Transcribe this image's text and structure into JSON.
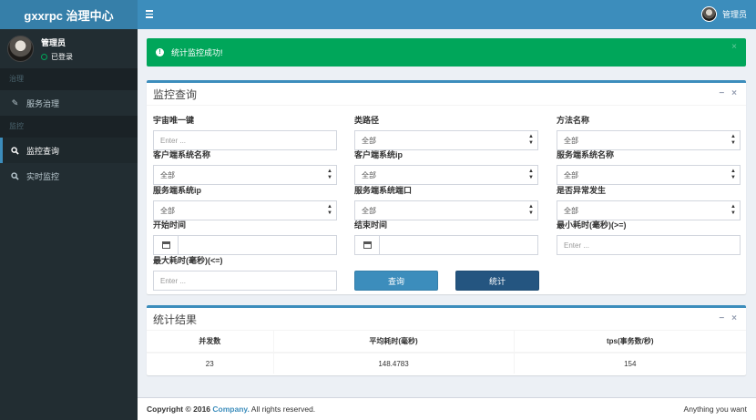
{
  "app": {
    "logo": "gxxrpc 治理中心"
  },
  "header": {
    "user_name": "管理员"
  },
  "sidebar": {
    "user": {
      "name": "管理员",
      "status": "已登录"
    },
    "sections": [
      {
        "header": "治理",
        "items": [
          {
            "label": "服务治理",
            "icon": "pencil-icon"
          }
        ]
      },
      {
        "header": "监控",
        "items": [
          {
            "label": "监控查询",
            "icon": "search-icon",
            "active": true
          },
          {
            "label": "实时监控",
            "icon": "search-icon"
          }
        ]
      }
    ]
  },
  "alert": {
    "message": "统计监控成功!",
    "close": "×",
    "color": "#00a65a"
  },
  "search": {
    "title": "监控查询",
    "fields": {
      "universe_key": {
        "label": "宇宙唯一键",
        "placeholder": "Enter ..."
      },
      "class_path": {
        "label": "类路径",
        "value": "全部"
      },
      "method_name": {
        "label": "方法名称",
        "value": "全部"
      },
      "client_system": {
        "label": "客户端系统名称",
        "value": "全部"
      },
      "client_ip": {
        "label": "客户端系统ip",
        "value": "全部"
      },
      "server_system": {
        "label": "服务端系统名称",
        "value": "全部"
      },
      "server_ip": {
        "label": "服务端系统ip",
        "value": "全部"
      },
      "server_port": {
        "label": "服务端系统端口",
        "value": "全部"
      },
      "exception": {
        "label": "是否异常发生",
        "value": "全部"
      },
      "start_time": {
        "label": "开始时间",
        "value": ""
      },
      "end_time": {
        "label": "结束时间",
        "value": ""
      },
      "min_cost": {
        "label": "最小耗时(毫秒)(>=)",
        "placeholder": "Enter ..."
      },
      "max_cost": {
        "label": "最大耗时(毫秒)(<=)",
        "placeholder": "Enter ..."
      }
    },
    "buttons": {
      "query": "查询",
      "stats": "统计"
    }
  },
  "results": {
    "title": "统计结果",
    "columns": [
      "并发数",
      "平均耗时(毫秒)",
      "tps(事务数/秒)"
    ],
    "rows": [
      [
        "23",
        "148.4783",
        "154"
      ]
    ]
  },
  "footer": {
    "copyright": "Copyright © 2016",
    "company": "Company.",
    "rights": "All rights reserved.",
    "right_text": "Anything you want"
  },
  "colors": {
    "header": "#3c8dbc",
    "logo_bg": "#367fa9",
    "sidebar": "#222d32",
    "success": "#00a65a",
    "primary": "#3c8dbc",
    "stats_button": "#245580"
  }
}
